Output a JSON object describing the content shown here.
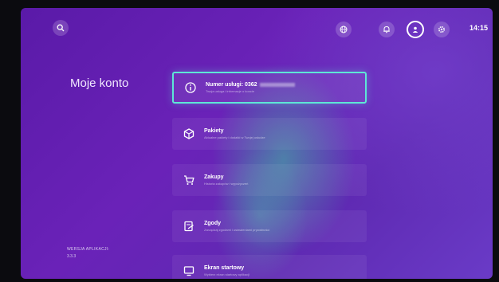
{
  "top_bar": {
    "icons": [
      "search-icon",
      "globe-icon",
      "bell-icon",
      "account-icon",
      "settings-icon"
    ],
    "clock": "14:15"
  },
  "page": {
    "title": "Moje konto"
  },
  "footer": {
    "version_label": "WERSJA APLIKACJI:",
    "version_value": "3.3.3"
  },
  "menu": [
    {
      "icon": "info-icon",
      "label": "Numer usługi: 0362",
      "sublabel": "Twoja usługa i informacje o koncie"
    },
    {
      "icon": "package-icon",
      "label": "Pakiety",
      "sublabel": "Aktualne pakiety i dodatki w Twojej usłudze"
    },
    {
      "icon": "cart-icon",
      "label": "Zakupy",
      "sublabel": "Historia zakupów i wypożyczeń"
    },
    {
      "icon": "consent-icon",
      "label": "Zgody",
      "sublabel": "Zarządzaj zgodami i ustawieniami prywatności"
    },
    {
      "icon": "screen-icon",
      "label": "Ekran startowy",
      "sublabel": "Wybierz ekran startowy aplikacji"
    }
  ]
}
